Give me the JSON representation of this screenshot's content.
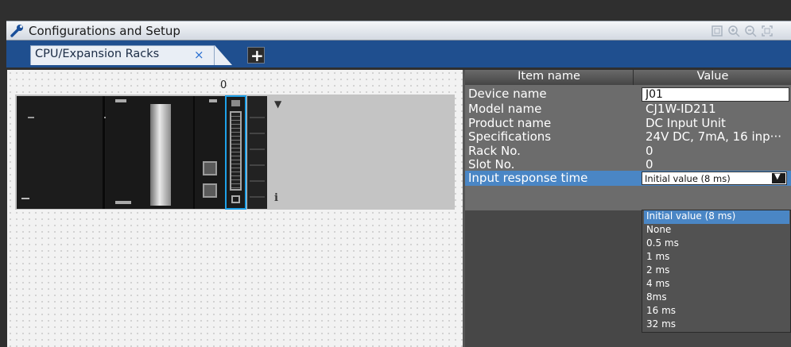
{
  "window": {
    "title": "Configurations and Setup"
  },
  "tabs": [
    {
      "label": "CPU/Expansion Racks",
      "close": "×"
    }
  ],
  "add_tab_label": "+",
  "rack": {
    "slot_number": "0",
    "info_label": "i"
  },
  "properties": {
    "headers": {
      "item_name": "Item name",
      "value": "Value"
    },
    "rows": [
      {
        "name": "Device name",
        "value": "J01"
      },
      {
        "name": "Model name",
        "value": "CJ1W-ID211"
      },
      {
        "name": "Product name",
        "value": "DC Input Unit"
      },
      {
        "name": "Specifications",
        "value": "24V DC, 7mA, 16 inp···"
      },
      {
        "name": "Rack No.",
        "value": "0"
      },
      {
        "name": "Slot No.",
        "value": "0"
      },
      {
        "name": "Input response time",
        "value": "Initial value (8 ms)"
      }
    ]
  },
  "dropdown_options": [
    "Initial value (8 ms)",
    "None",
    "0.5 ms",
    "1 ms",
    "2 ms",
    "4 ms",
    "8ms",
    "16 ms",
    "32 ms"
  ],
  "colors": {
    "accent_blue": "#1f4f8f",
    "selection": "#4a86c5",
    "selected_unit_border": "#1ea0e8"
  },
  "icons": {
    "title": "wrench-icon",
    "zoom_tools": [
      "fit-icon",
      "zoom-in-icon",
      "zoom-out-icon",
      "full-screen-icon"
    ],
    "dropdown": "triangle-down-icon"
  }
}
